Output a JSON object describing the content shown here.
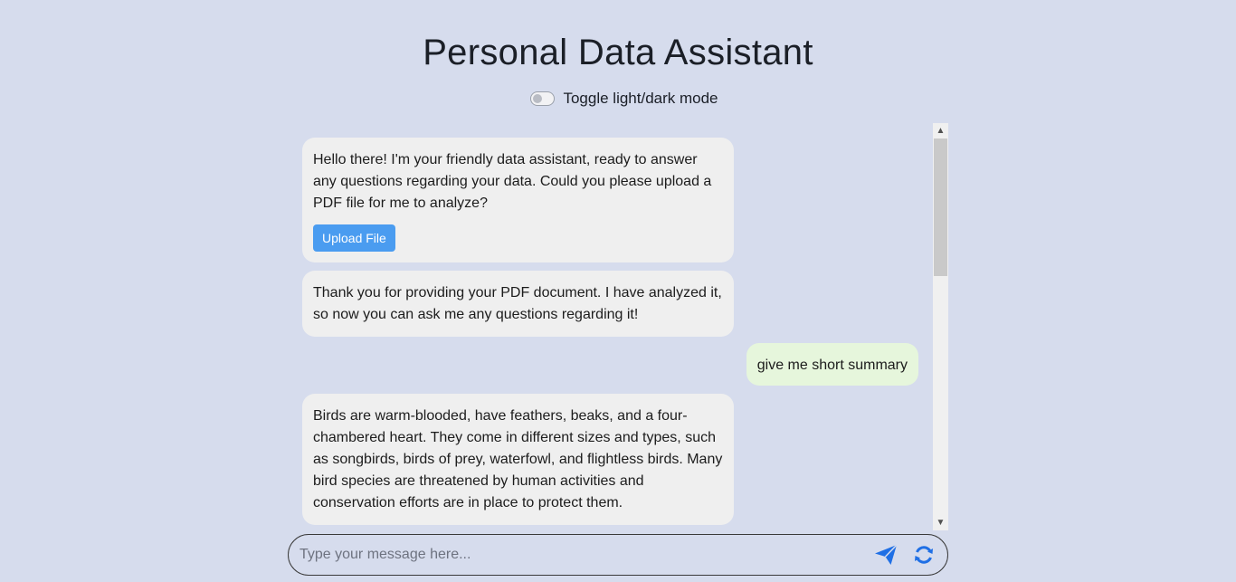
{
  "header": {
    "title": "Personal Data Assistant",
    "toggle_label": "Toggle light/dark mode",
    "dark_mode": false
  },
  "messages": [
    {
      "role": "assistant",
      "text": "Hello there! I'm your friendly data assistant, ready to answer any questions regarding your data. Could you please upload a PDF file for me to analyze?",
      "button_label": "Upload File"
    },
    {
      "role": "assistant",
      "text": "Thank you for providing your PDF document. I have analyzed it, so now you can ask me any questions regarding it!"
    },
    {
      "role": "user",
      "text": "give me short summary"
    },
    {
      "role": "assistant",
      "text": "Birds are warm-blooded, have feathers, beaks, and a four-chambered heart. They come in different sizes and types, such as songbirds, birds of prey, waterfowl, and flightless birds. Many bird species are threatened by human activities and conservation efforts are in place to protect them."
    }
  ],
  "composer": {
    "placeholder": "Type your message here...",
    "value": "",
    "send_icon": "send-icon",
    "refresh_icon": "refresh-icon"
  },
  "colors": {
    "background": "#d6dced",
    "bot_bubble": "#efefef",
    "user_bubble": "#e6f6dc",
    "accent": "#1f6fe5",
    "upload_button": "#4a9cf0"
  }
}
